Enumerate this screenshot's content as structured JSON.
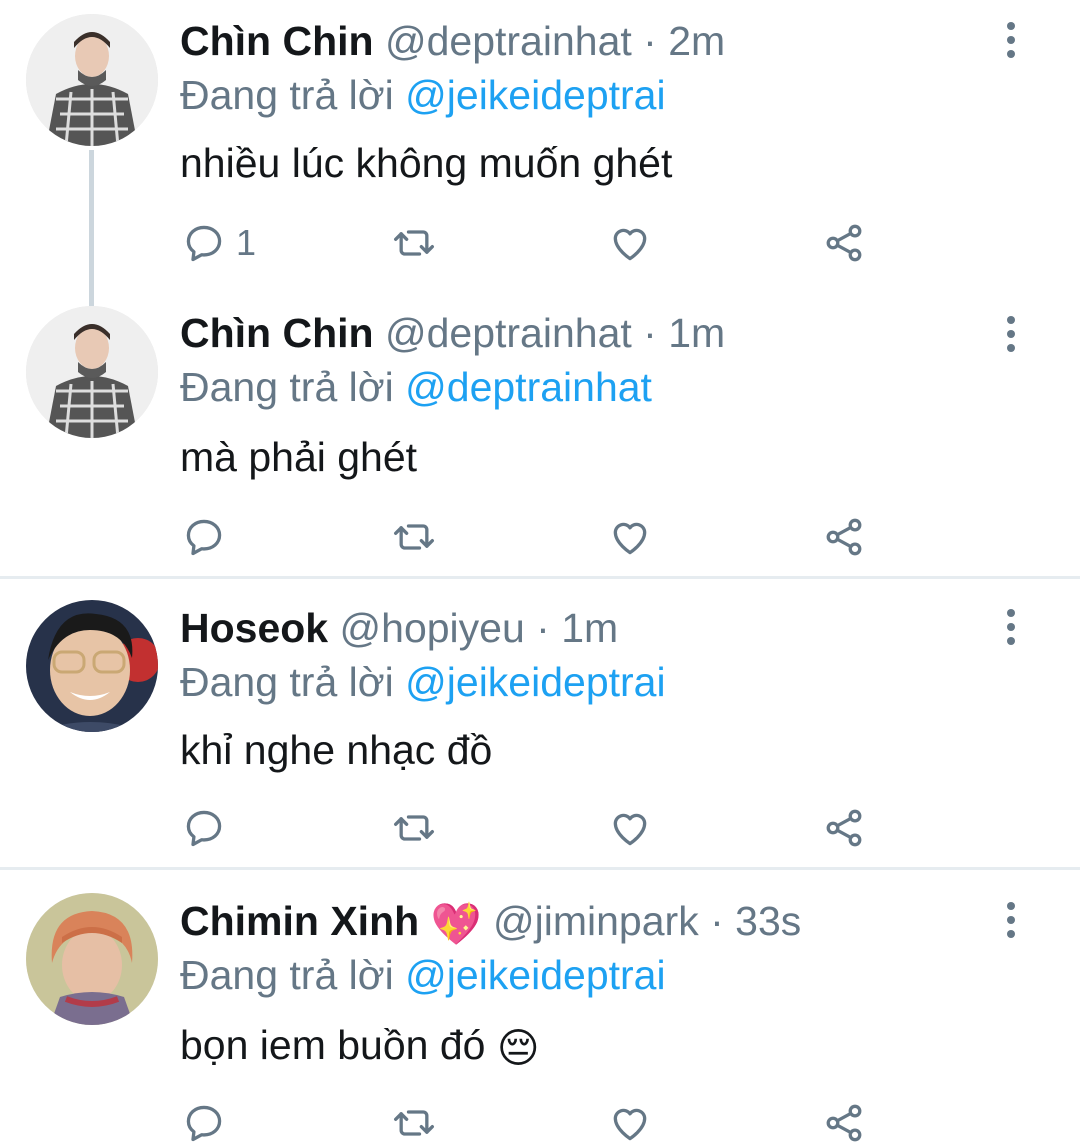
{
  "tweets": [
    {
      "name": "Chìn Chin",
      "handle": "@deptrainhat",
      "sep": "·",
      "time": "2m",
      "reply_prefix": "Đang trả lời",
      "reply_to": "@jeikeideptrai",
      "text": "nhiều lúc không muốn ghét",
      "reply_count": "1"
    },
    {
      "name": "Chìn Chin",
      "handle": "@deptrainhat",
      "sep": "·",
      "time": "1m",
      "reply_prefix": "Đang trả lời",
      "reply_to": "@deptrainhat",
      "text": "mà phải ghét",
      "reply_count": ""
    },
    {
      "name": "Hoseok",
      "handle": "@hopiyeu",
      "sep": "·",
      "time": "1m",
      "reply_prefix": "Đang trả lời",
      "reply_to": "@jeikeideptrai",
      "text": "khỉ nghe nhạc đồ",
      "reply_count": ""
    },
    {
      "name": "Chimin Xinh",
      "name_emoji": "💖",
      "handle": "@jiminpark",
      "sep": "·",
      "time": "33s",
      "reply_prefix": "Đang trả lời",
      "reply_to": "@jeikeideptrai",
      "text": "bọn iem buồn đó",
      "text_emoji": "😔",
      "reply_count": ""
    }
  ],
  "icons": {
    "reply": "reply-icon",
    "retweet": "retweet-icon",
    "like": "heart-icon",
    "share": "share-icon",
    "menu": "more-vertical-icon"
  },
  "colors": {
    "mention": "#1da1f2",
    "secondary_text": "#657786",
    "primary_text": "#14171a",
    "divider": "#e6ecf0"
  }
}
